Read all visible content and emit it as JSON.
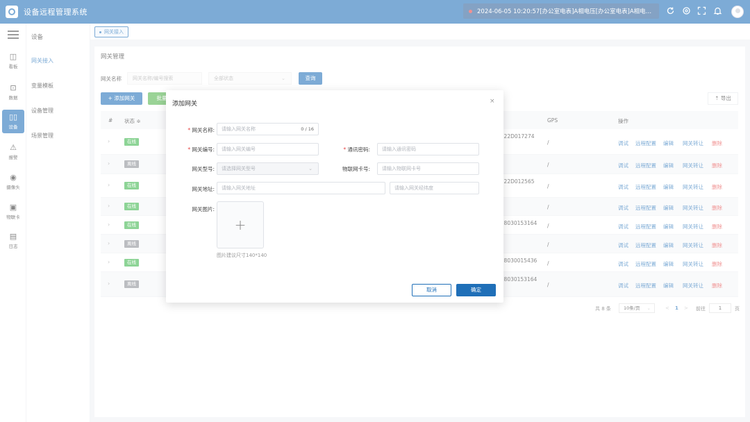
{
  "header": {
    "app_title": "设备远程管理系统",
    "notice": "2024-06-05 10:20:57[办公室电表]A相电压[办公室电表]A相电…",
    "icons": [
      "refresh-icon",
      "settings-icon",
      "fullscreen-icon",
      "bell-icon"
    ]
  },
  "rail": {
    "items": [
      {
        "label": "看板",
        "icon": "dashboard-icon"
      },
      {
        "label": "数据",
        "icon": "chart-icon"
      },
      {
        "label": "设备",
        "icon": "device-icon"
      },
      {
        "label": "报警",
        "icon": "alarm-icon"
      },
      {
        "label": "摄像头",
        "icon": "camera-icon"
      },
      {
        "label": "物联卡",
        "icon": "sim-card-icon"
      },
      {
        "label": "日志",
        "icon": "log-icon"
      }
    ],
    "active_index": 2
  },
  "submenu": {
    "title": "设备",
    "items": [
      "网关接入",
      "变量模板",
      "设备管理",
      "场景管理"
    ],
    "active_index": 0
  },
  "tabs": [
    {
      "label": "网关接入"
    }
  ],
  "page": {
    "title": "网关管理",
    "filter_label": "网关名称",
    "search_placeholder": "网关名称/编号搜索",
    "status_select": "全部状态",
    "query_button": "查询",
    "add_button": "+ 添加网关",
    "batch_button": "批量",
    "export_button": "导出"
  },
  "table": {
    "headers": {
      "index": "#",
      "status": "状态 ≑",
      "gps": "GPS",
      "actions": "操作"
    },
    "rows": [
      {
        "status": "在线",
        "online": true,
        "sn": "2622D017274"
      },
      {
        "status": "离线",
        "online": false,
        "sn": ""
      },
      {
        "status": "在线",
        "online": true,
        "sn": "2622D012565"
      },
      {
        "status": "在线",
        "online": true,
        "sn": ""
      },
      {
        "status": "在线",
        "online": true,
        "sn": "268030153164"
      },
      {
        "status": "离线",
        "online": false,
        "sn": ""
      },
      {
        "status": "在线",
        "online": true,
        "sn": "268030015436"
      },
      {
        "status": "离线",
        "online": false,
        "sn": "268030153164"
      }
    ],
    "gps_value": "/",
    "actions": {
      "debug": "调试",
      "remote": "远程配置",
      "edit": "编辑",
      "transfer": "网关转让",
      "delete": "删除"
    }
  },
  "pager": {
    "total": "共 8 条",
    "page_size": "10条/页",
    "prev": "<",
    "current": "1",
    "next": ">",
    "goto_label": "前往",
    "goto_value": "1",
    "page_suffix": "页"
  },
  "modal": {
    "title": "添加网关",
    "close": "×",
    "fields": {
      "name": {
        "label": "网关名称:",
        "placeholder": "请输入网关名称",
        "counter": "0 / 16"
      },
      "code": {
        "label": "网关编号:",
        "placeholder": "请输入网关编号"
      },
      "password": {
        "label": "通讯密码:",
        "placeholder": "请输入通讯密码"
      },
      "model": {
        "label": "网关型号:",
        "placeholder": "请选择网关型号"
      },
      "sim": {
        "label": "物联网卡号:",
        "placeholder": "请输入物联网卡号"
      },
      "address": {
        "label": "网关地址:",
        "placeholder": "请输入网关地址"
      },
      "coords": {
        "placeholder": "请输入网关经纬度"
      },
      "image": {
        "label": "网关图片:",
        "hint": "图片建议尺寸140*140"
      }
    },
    "cancel": "取消",
    "confirm": "确定"
  },
  "colors": {
    "primary": "#1f6fb8",
    "online": "#3cb54a",
    "offline": "#8b8e94",
    "danger": "#e64242"
  }
}
